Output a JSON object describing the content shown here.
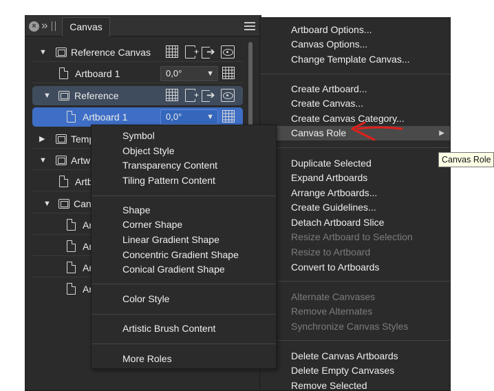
{
  "panel": {
    "tab_label": "Canvas",
    "icons": {
      "close": "close-icon",
      "collapse": "double-chevron-icon",
      "grip": "grip-icon",
      "menu": "hamburger-icon"
    },
    "rows": [
      {
        "label": "Reference Canvas",
        "type": "canvas",
        "expanded": true
      },
      {
        "label": "Artboard 1",
        "type": "artboard",
        "rotation": "0,0°"
      },
      {
        "label": "Reference",
        "type": "canvas",
        "expanded": true
      },
      {
        "label": "Artboard 1",
        "type": "artboard",
        "rotation": "0,0°",
        "selected": true
      },
      {
        "label": "Temp",
        "type": "canvas",
        "expanded": false
      },
      {
        "label": "Artw",
        "type": "canvas",
        "expanded": true
      },
      {
        "label": "Artb",
        "type": "artboard"
      },
      {
        "label": "Can",
        "type": "canvas",
        "expanded": true
      },
      {
        "label": "Ar",
        "type": "artboard"
      },
      {
        "label": "Ar",
        "type": "artboard"
      },
      {
        "label": "Ar",
        "type": "artboard"
      },
      {
        "label": "Ar",
        "type": "artboard"
      }
    ]
  },
  "main_menu": {
    "items": [
      "Artboard Options...",
      "Canvas Options...",
      "Change Template Canvas...",
      "Create Artboard...",
      "Create Canvas...",
      "Create Canvas Category...",
      "Canvas Role",
      "Duplicate Selected",
      "Expand Artboards",
      "Arrange Artboards...",
      "Create Guidelines...",
      "Detach Artboard Slice",
      "Resize Artboard to Selection",
      "Resize to Artboard",
      "Convert to Artboards",
      "Alternate Canvases",
      "Remove Alternates",
      "Synchronize Canvas Styles",
      "Delete Canvas Artboards",
      "Delete Empty Canvases",
      "Remove Selected"
    ],
    "disabled": [
      "Resize Artboard to Selection",
      "Resize to Artboard",
      "Alternate Canvases",
      "Remove Alternates",
      "Synchronize Canvas Styles"
    ],
    "highlighted": "Canvas Role",
    "submenu_arrow": "▶"
  },
  "sub_menu": {
    "items": [
      "Symbol",
      "Object Style",
      "Transparency Content",
      "Tiling Pattern Content",
      "Shape",
      "Corner Shape",
      "Linear Gradient Shape",
      "Concentric Gradient Shape",
      "Conical Gradient Shape",
      "Color Style",
      "Artistic Brush Content",
      "More Roles"
    ]
  },
  "tooltip": {
    "text": "Canvas Role"
  },
  "colors": {
    "panel_bg": "#2b2b2b",
    "selection": "#3e6ec5",
    "selection_parent": "#3f4c5d",
    "menu_highlight": "#4a4a4a",
    "disabled_text": "#7c7c7c",
    "annotation": "#e0201c"
  }
}
